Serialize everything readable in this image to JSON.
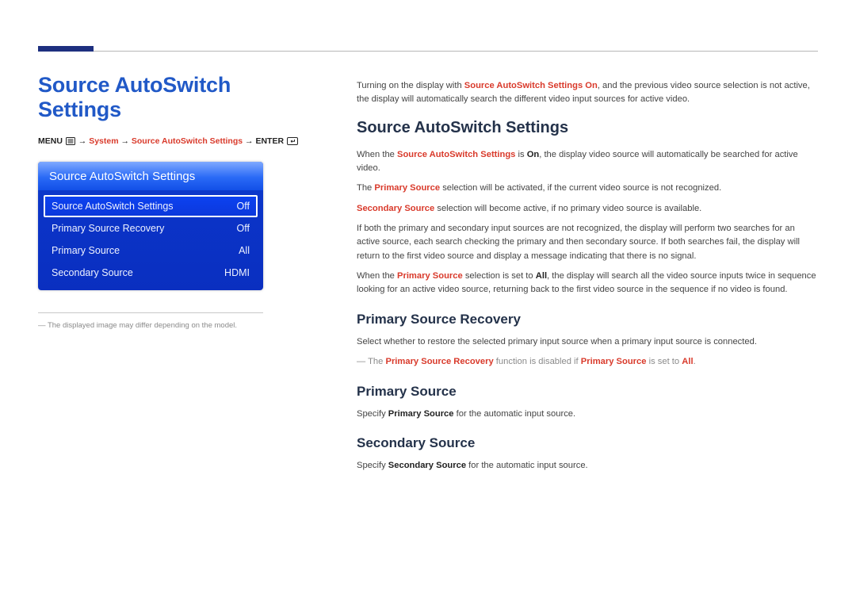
{
  "title": "Source AutoSwitch Settings",
  "breadcrumb": {
    "menu": "MENU",
    "arrow": "→",
    "system": "System",
    "sas": "Source AutoSwitch Settings",
    "enter": "ENTER"
  },
  "osd": {
    "header": "Source AutoSwitch Settings",
    "rows": [
      {
        "label": "Source AutoSwitch Settings",
        "value": "Off",
        "selected": true
      },
      {
        "label": "Primary Source Recovery",
        "value": "Off",
        "selected": false
      },
      {
        "label": "Primary Source",
        "value": "All",
        "selected": false
      },
      {
        "label": "Secondary Source",
        "value": "HDMI",
        "selected": false
      }
    ]
  },
  "note_image_differ": "The displayed image may differ depending on the model.",
  "intro": {
    "p1_a": "Turning on the display with ",
    "p1_b": "Source AutoSwitch Settings",
    "p1_c": " ",
    "p1_d": "On",
    "p1_e": ", and the previous video source selection is not active, the display will automatically search the different video input sources for active video."
  },
  "section_sas": {
    "heading": "Source AutoSwitch Settings",
    "p1_a": "When the ",
    "p1_b": "Source AutoSwitch Settings",
    "p1_c": " is ",
    "p1_d": "On",
    "p1_e": ", the display video source will automatically be searched for active video.",
    "p2_a": "The ",
    "p2_b": "Primary Source",
    "p2_c": " selection will be activated, if the current video source is not recognized.",
    "p3_a": "Secondary Source",
    "p3_b": " selection will become active, if no primary video source is available.",
    "p4": "If both the primary and secondary input sources are not recognized, the display will perform two searches for an active source, each search checking the primary and then secondary source. If both searches fail, the display will return to the first video source and display a message indicating that there is no signal.",
    "p5_a": "When the ",
    "p5_b": "Primary Source",
    "p5_c": " selection is set to ",
    "p5_d": "All",
    "p5_e": ", the display will search all the video source inputs twice in sequence looking for an active video source, returning back to the first video source in the sequence if no video is found."
  },
  "section_psr": {
    "heading": "Primary Source Recovery",
    "p1": "Select whether to restore the selected primary input source when a primary input source is connected.",
    "note_a": "The ",
    "note_b": "Primary Source Recovery",
    "note_c": " function is disabled if ",
    "note_d": "Primary Source",
    "note_e": " is set to ",
    "note_f": "All",
    "note_g": "."
  },
  "section_ps": {
    "heading": "Primary Source",
    "p1_a": "Specify ",
    "p1_b": "Primary Source",
    "p1_c": " for the automatic input source."
  },
  "section_ss": {
    "heading": "Secondary Source",
    "p1_a": "Specify ",
    "p1_b": "Secondary Source",
    "p1_c": " for the automatic input source."
  }
}
